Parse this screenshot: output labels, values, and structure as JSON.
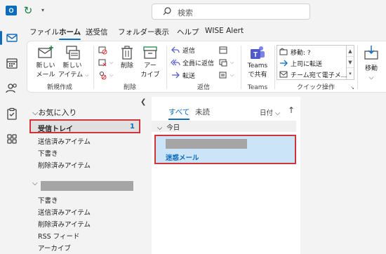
{
  "titlebar": {
    "search_placeholder": "検索",
    "app_icon_letter": "O"
  },
  "tabs": [
    {
      "label": "ファイル",
      "active": false
    },
    {
      "label": "ホーム",
      "active": true
    },
    {
      "label": "送受信",
      "active": false
    },
    {
      "label": "フォルダー",
      "active": false
    },
    {
      "label": "表示",
      "active": false
    },
    {
      "label": "ヘルプ",
      "active": false
    },
    {
      "label": "WISE Alert",
      "active": false
    }
  ],
  "ribbon": {
    "new_mail_label_1": "新しい",
    "new_mail_label_2": "メール",
    "new_items_label_1": "新しい",
    "new_items_label_2": "アイテム",
    "group_new": "新規作成",
    "delete_label": "削除",
    "archive_label_1": "アー",
    "archive_label_2": "カイブ",
    "group_delete": "削除",
    "reply_label": "返信",
    "reply_all_label": "全員に返信",
    "forward_label": "転送",
    "group_respond": "返信",
    "teams_label_1": "Teams",
    "teams_label_2": "で共有",
    "group_teams": "Teams",
    "quick_steps": [
      "移動: ?",
      "上司に転送",
      "チーム宛て電子メ..."
    ],
    "group_quick": "クイック操作",
    "move_label": "移動"
  },
  "folders": {
    "favorites_header": "お気に入り",
    "inbox_label": "受信トレイ",
    "inbox_count": "1",
    "fav_items": [
      "送信済みアイテム",
      "下書き",
      "削除済みアイテム"
    ],
    "account_items": [
      "下書き",
      "送信済みアイテム",
      "削除済みアイテム",
      "RSS フィード",
      "アーカイブ"
    ]
  },
  "messages": {
    "tab_all": "すべて",
    "tab_unread": "未読",
    "sort_label": "日付",
    "group_today": "今日",
    "message_subject": "迷惑メール"
  }
}
